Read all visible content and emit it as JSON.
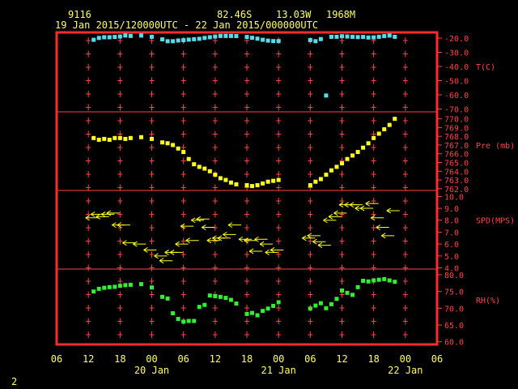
{
  "header": {
    "station_id": "9116",
    "lat": "82.46S",
    "lon": "13.03W",
    "elev": "1968M",
    "time_range": "19 Jan 2015/120000UTC - 22 Jan 2015/000000UTC"
  },
  "page_number": "2",
  "colors": {
    "frame": "#ff2a2a",
    "grid": "#ff4444",
    "text": "#ffff66",
    "label": "#ff4444",
    "temp": "#55ddee",
    "pres": "#ffff22",
    "wind": "#ffff22",
    "rh": "#33ee33"
  },
  "chart_data": [
    {
      "type": "scatter",
      "ylabel": "T(C)",
      "yticks": [
        -20.0,
        -30.0,
        -40.0,
        -50.0,
        -60.0,
        -70.0
      ],
      "yticklabels": [
        "-20.0",
        "-30.0",
        "-40.0",
        "-50.0",
        "-60.0",
        "-70.0"
      ],
      "ylim": [
        -72,
        -16
      ],
      "x_hours": [
        13,
        14,
        15,
        16,
        17,
        18,
        19,
        20,
        22,
        24,
        26,
        27,
        28,
        29,
        30,
        31,
        32,
        33,
        34,
        35,
        36,
        37,
        38,
        39,
        40,
        42,
        43,
        44,
        45,
        46,
        47,
        48,
        54,
        55,
        56,
        57,
        58,
        59,
        60,
        61,
        62,
        63,
        64,
        65,
        66,
        67,
        68,
        69,
        70
      ],
      "values": [
        -21.2,
        -19.9,
        -19.4,
        -19.4,
        -19.2,
        -18.9,
        -18.2,
        -18.5,
        -18.2,
        -19.1,
        -20.9,
        -22.2,
        -22.2,
        -21.7,
        -21.5,
        -21.1,
        -20.8,
        -20.5,
        -19.9,
        -19.4,
        -18.9,
        -18.5,
        -18.5,
        -18.5,
        -18.6,
        -19.2,
        -19.8,
        -20.4,
        -21.2,
        -21.8,
        -22.1,
        -22.1,
        -21.4,
        -22.2,
        -20.7,
        -60.5,
        -19.1,
        -19.1,
        -18.7,
        -18.9,
        -19.1,
        -19.3,
        -19.2,
        -19.6,
        -19.5,
        -19.1,
        -18.6,
        -18.2,
        -19.1
      ]
    },
    {
      "type": "scatter",
      "ylabel": "Pre (mb)",
      "yticks": [
        770,
        769,
        768,
        767,
        766,
        765,
        764,
        763,
        762
      ],
      "yticklabels": [
        "770.0",
        "769.0",
        "768.0",
        "767.0",
        "766.0",
        "765.0",
        "764.0",
        "763.0",
        "762.0"
      ],
      "ylim": [
        761.8,
        770.8
      ],
      "x_hours": [
        13,
        14,
        15,
        16,
        17,
        18,
        19,
        20,
        22,
        24,
        26,
        27,
        28,
        29,
        30,
        31,
        32,
        33,
        34,
        35,
        36,
        37,
        38,
        39,
        40,
        42,
        43,
        44,
        45,
        46,
        47,
        48,
        54,
        55,
        56,
        57,
        58,
        59,
        60,
        61,
        62,
        63,
        64,
        65,
        66,
        67,
        68,
        69,
        70
      ],
      "values": [
        767.8,
        767.6,
        767.7,
        767.6,
        767.8,
        767.8,
        767.7,
        767.8,
        767.9,
        767.7,
        767.3,
        767.2,
        767.0,
        766.6,
        766.2,
        765.4,
        764.8,
        764.5,
        764.3,
        764.0,
        763.6,
        763.2,
        763.0,
        762.7,
        762.5,
        762.4,
        762.3,
        762.4,
        762.6,
        762.8,
        762.9,
        763.0,
        762.4,
        762.8,
        763.1,
        763.6,
        764.1,
        764.5,
        764.9,
        765.4,
        765.8,
        766.2,
        766.7,
        767.2,
        767.8,
        768.3,
        768.8,
        769.3,
        770.0
      ],
      "omitted_visual_note": ""
    },
    {
      "type": "wind_barbs",
      "ylabel": "SPD(MPS)",
      "yticks": [
        10,
        9,
        8,
        7,
        6,
        5,
        4
      ],
      "yticklabels": [
        "10.0",
        "9.0",
        "8.0",
        "7.0",
        "6.0",
        "5.0",
        "4.0"
      ],
      "ylim": [
        3.9,
        10.5
      ],
      "x_hours": [
        13,
        14,
        15,
        16,
        17,
        18,
        19,
        20,
        22,
        24,
        26,
        27,
        28,
        29,
        30,
        31,
        32,
        33,
        34,
        35,
        36,
        37,
        38,
        39,
        40,
        42,
        43,
        44,
        45,
        46,
        47,
        48,
        54,
        55,
        56,
        57,
        58,
        59,
        60,
        61,
        62,
        63,
        64,
        65,
        66,
        67,
        68,
        69,
        70
      ],
      "values": [
        8.2,
        8.5,
        8.3,
        8.5,
        8.6,
        7.6,
        7.6,
        6.1,
        6.0,
        5.5,
        5.0,
        4.6,
        5.3,
        5.3,
        6.0,
        7.5,
        6.3,
        8.0,
        8.1,
        7.4,
        6.3,
        6.5,
        6.5,
        6.8,
        7.6,
        6.4,
        6.3,
        5.4,
        6.4,
        6.0,
        5.3,
        5.5,
        6.5,
        6.7,
        6.2,
        5.9,
        8.0,
        8.3,
        8.6,
        9.3,
        9.3,
        9.3,
        9.0,
        9.0,
        9.4,
        8.2,
        7.4,
        6.7,
        8.8
      ]
    },
    {
      "type": "scatter",
      "ylabel": "RH(%)",
      "yticks": [
        80,
        75,
        70,
        65,
        60
      ],
      "yticklabels": [
        "80.0",
        "75.0",
        "70.0",
        "65.0",
        "60.0"
      ],
      "ylim": [
        59.2,
        81.7
      ],
      "x_hours": [
        13,
        14,
        15,
        16,
        17,
        18,
        19,
        20,
        22,
        24,
        26,
        27,
        28,
        29,
        30,
        31,
        32,
        33,
        34,
        35,
        36,
        37,
        38,
        39,
        40,
        42,
        43,
        44,
        45,
        46,
        47,
        48,
        54,
        55,
        56,
        57,
        58,
        59,
        60,
        61,
        62,
        63,
        64,
        65,
        66,
        67,
        68,
        69,
        70
      ],
      "values": [
        75.0,
        75.8,
        76.1,
        76.3,
        76.4,
        76.7,
        76.9,
        77.0,
        77.2,
        76.2,
        73.4,
        72.9,
        68.5,
        66.8,
        66.0,
        66.2,
        66.2,
        70.4,
        71.0,
        73.8,
        73.6,
        73.4,
        73.1,
        72.5,
        71.4,
        68.3,
        68.6,
        67.9,
        69.2,
        69.9,
        70.7,
        71.8,
        69.9,
        70.8,
        71.5,
        70.0,
        71.2,
        72.8,
        75.3,
        74.6,
        74.0,
        76.3,
        78.2,
        78.0,
        78.3,
        78.5,
        78.7,
        78.3,
        77.9
      ]
    }
  ],
  "x_axis": {
    "hour_labels": [
      "06",
      "12",
      "18",
      "00",
      "06",
      "12",
      "18",
      "00",
      "06",
      "12",
      "18",
      "00",
      "06"
    ],
    "hour_values": [
      6,
      12,
      18,
      24,
      30,
      36,
      42,
      48,
      54,
      60,
      66,
      72,
      78
    ],
    "date_labels": [
      "20 Jan",
      "21 Jan",
      "22 Jan"
    ],
    "date_hours": [
      24,
      48,
      72
    ]
  }
}
